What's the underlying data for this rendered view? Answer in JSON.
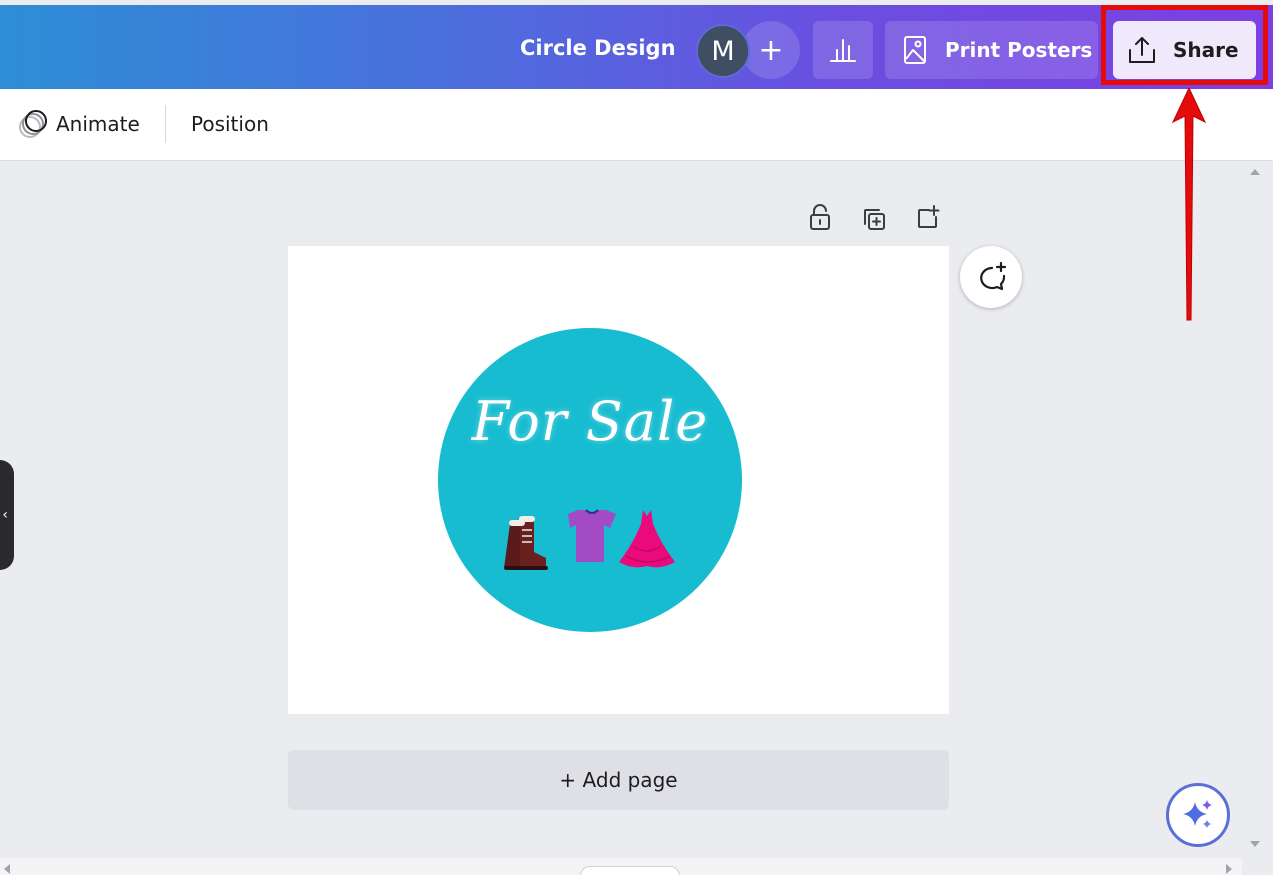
{
  "header": {
    "title": "Circle Design",
    "avatar_initial": "M",
    "add_collaborator": "+",
    "print_label": "Print Posters",
    "share_label": "Share"
  },
  "toolbar": {
    "animate_label": "Animate",
    "position_label": "Position"
  },
  "canvas": {
    "design_text": "For Sale",
    "add_page_label": "+ Add page"
  },
  "colors": {
    "accent": "#7d3fe3",
    "circle": "#17bcd0",
    "highlight": "#e30b0b"
  },
  "icons": [
    "bar-chart-icon",
    "image-frame-icon",
    "upload-icon",
    "lock-open-icon",
    "duplicate-icon",
    "add-page-icon",
    "comment-add-icon",
    "magic-sparkle-icon",
    "animate-icon"
  ]
}
